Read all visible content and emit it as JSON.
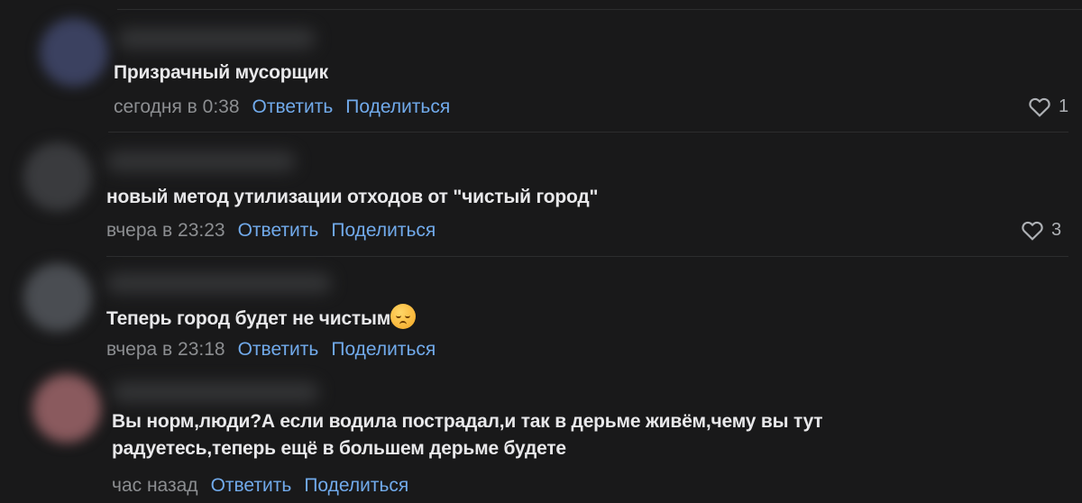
{
  "comments": [
    {
      "text": "Призрачный мусорщик",
      "time": "сегодня в 0:38",
      "reply": "Ответить",
      "share": "Поделиться",
      "likes": "1"
    },
    {
      "text": "новый метод утилизации отходов от \"чистый город\"",
      "time": "вчера в 23:23",
      "reply": "Ответить",
      "share": "Поделиться",
      "likes": "3"
    },
    {
      "text": "Теперь город будет не чистым",
      "emoji": "pensive-face",
      "time": "вчера в 23:18",
      "reply": "Ответить",
      "share": "Поделиться"
    },
    {
      "text": "Вы норм,люди?А если водила пострадал,и так в дерьме живём,чему вы тут радуетесь,теперь ещё в большем дерьме будете",
      "time": "час назад",
      "reply": "Ответить",
      "share": "Поделиться"
    }
  ]
}
